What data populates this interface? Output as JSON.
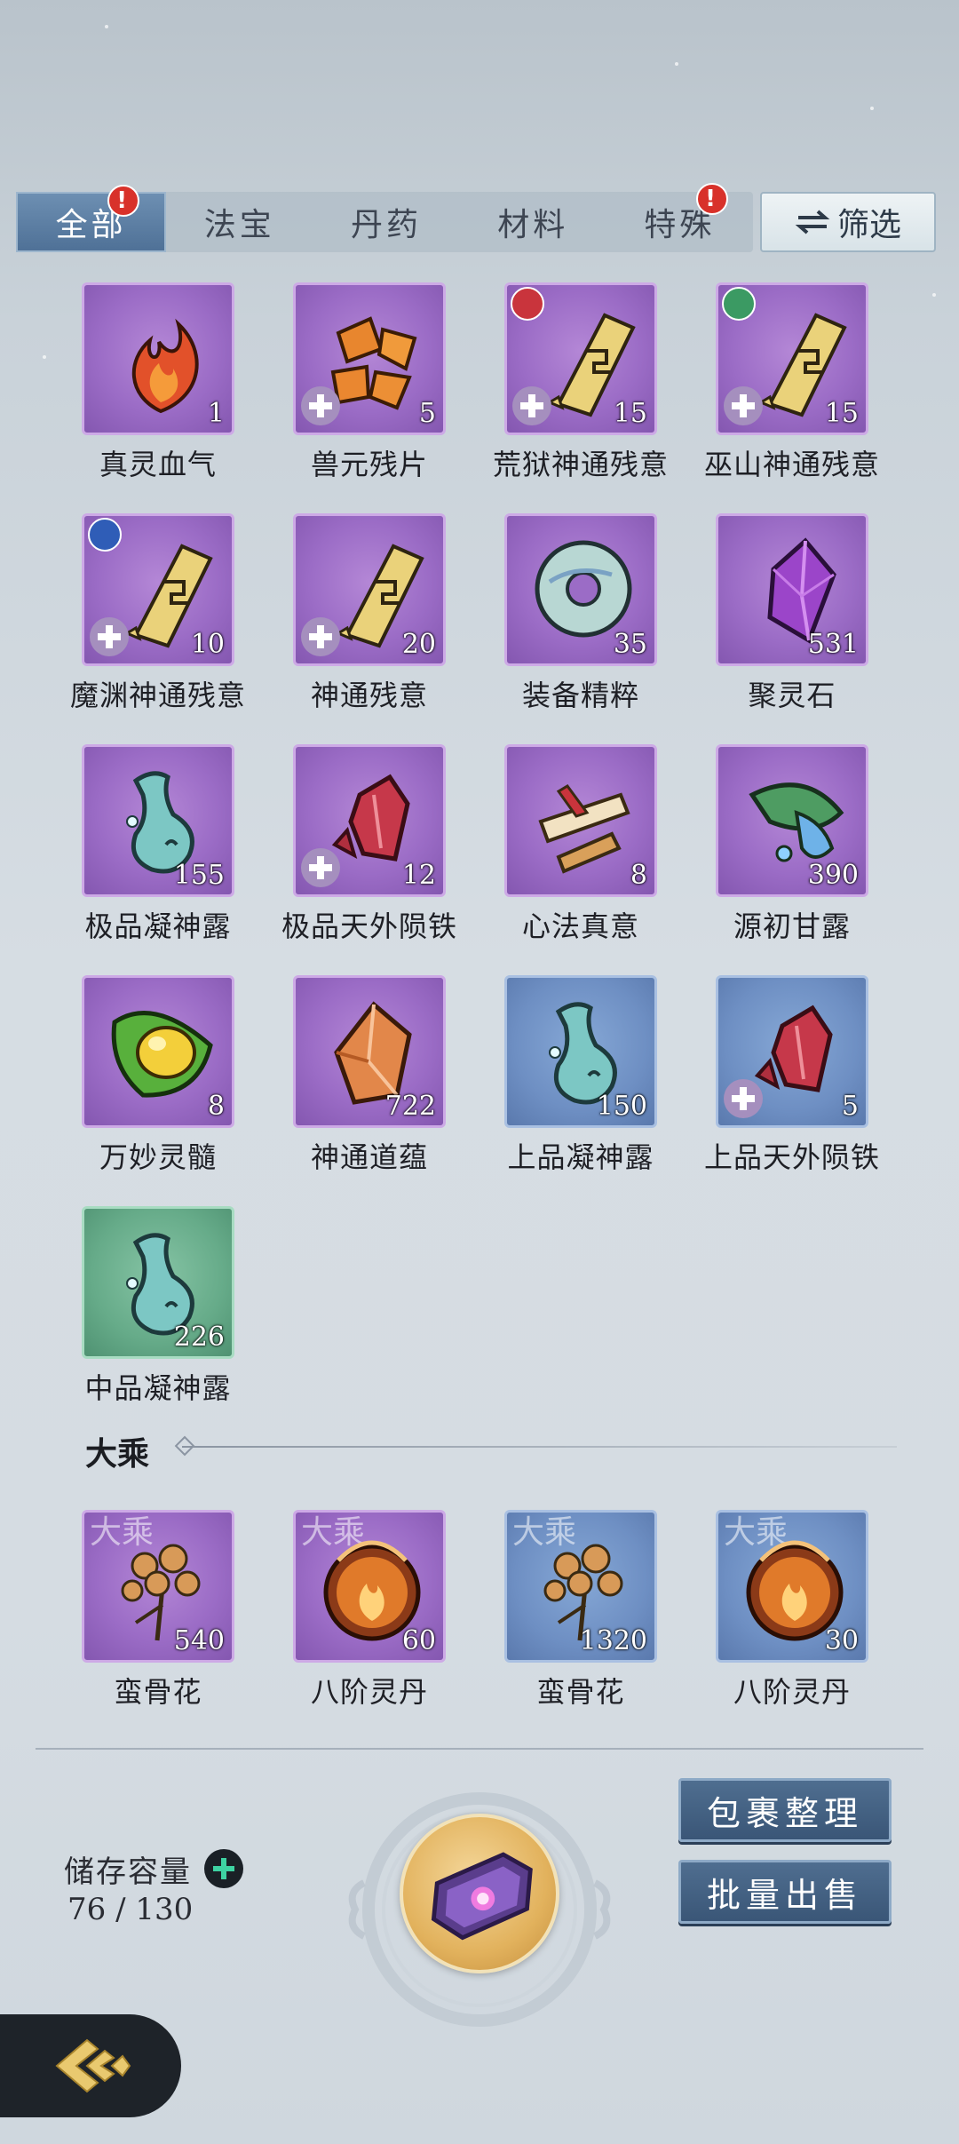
{
  "tabs": [
    {
      "label": "全部",
      "active": true,
      "alert": true
    },
    {
      "label": "法宝",
      "active": false,
      "alert": false
    },
    {
      "label": "丹药",
      "active": false,
      "alert": false
    },
    {
      "label": "材料",
      "active": false,
      "alert": false
    },
    {
      "label": "特殊",
      "active": false,
      "alert": true
    }
  ],
  "alert_mark": "!",
  "filter_label": "筛选",
  "items": [
    {
      "name": "真灵血气",
      "count": "1",
      "rarity": "purple",
      "icon": "flame-essence-icon"
    },
    {
      "name": "兽元残片",
      "count": "5",
      "rarity": "purple",
      "icon": "beast-shard-icon",
      "plus": true
    },
    {
      "name": "荒狱神通残意",
      "count": "15",
      "rarity": "purple",
      "icon": "talisman-scroll-icon",
      "plus": true,
      "sect": "red"
    },
    {
      "name": "巫山神通残意",
      "count": "15",
      "rarity": "purple",
      "icon": "talisman-scroll-icon",
      "plus": true,
      "sect": "green"
    },
    {
      "name": "魔渊神通残意",
      "count": "10",
      "rarity": "purple",
      "icon": "talisman-scroll-icon",
      "plus": true,
      "sect": "blue"
    },
    {
      "name": "神通残意",
      "count": "20",
      "rarity": "purple",
      "icon": "talisman-scroll-icon",
      "plus": true
    },
    {
      "name": "装备精粹",
      "count": "35",
      "rarity": "purple",
      "icon": "jade-ring-icon"
    },
    {
      "name": "聚灵石",
      "count": "531",
      "rarity": "purple",
      "icon": "spirit-crystal-icon"
    },
    {
      "name": "极品凝神露",
      "count": "155",
      "rarity": "purple",
      "icon": "dew-vase-icon"
    },
    {
      "name": "极品天外陨铁",
      "count": "12",
      "rarity": "purple",
      "icon": "meteor-iron-icon",
      "plus": true
    },
    {
      "name": "心法真意",
      "count": "8",
      "rarity": "purple",
      "icon": "scattered-scrolls-icon"
    },
    {
      "name": "源初甘露",
      "count": "390",
      "rarity": "purple",
      "icon": "leaf-dew-icon"
    },
    {
      "name": "万妙灵髓",
      "count": "8",
      "rarity": "purple",
      "icon": "leaf-pearl-icon"
    },
    {
      "name": "神通道蕴",
      "count": "722",
      "rarity": "purple",
      "icon": "amber-crystal-icon"
    },
    {
      "name": "上品凝神露",
      "count": "150",
      "rarity": "blue",
      "icon": "dew-vase-icon"
    },
    {
      "name": "上品天外陨铁",
      "count": "5",
      "rarity": "blue",
      "icon": "meteor-iron-icon",
      "plus": true
    },
    {
      "name": "中品凝神露",
      "count": "226",
      "rarity": "green",
      "icon": "dew-vase-icon"
    }
  ],
  "section": {
    "title": "大乘",
    "watermark": "大乘",
    "items": [
      {
        "name": "蛮骨花",
        "count": "540",
        "rarity": "purple",
        "icon": "bone-flower-icon"
      },
      {
        "name": "八阶灵丹",
        "count": "60",
        "rarity": "purple",
        "icon": "fire-pill-icon"
      },
      {
        "name": "蛮骨花",
        "count": "1320",
        "rarity": "blue",
        "icon": "bone-flower-icon"
      },
      {
        "name": "八阶灵丹",
        "count": "30",
        "rarity": "blue",
        "icon": "fire-pill-icon"
      }
    ]
  },
  "storage": {
    "label": "储存容量",
    "value": "76 / 130"
  },
  "actions": {
    "organize": "包裹整理",
    "sell": "批量出售"
  },
  "colors": {
    "purple_tile": "#9b6cc6",
    "blue_tile": "#6e8fc3",
    "green_tile": "#66ab89",
    "button": "#3f5c7e"
  }
}
